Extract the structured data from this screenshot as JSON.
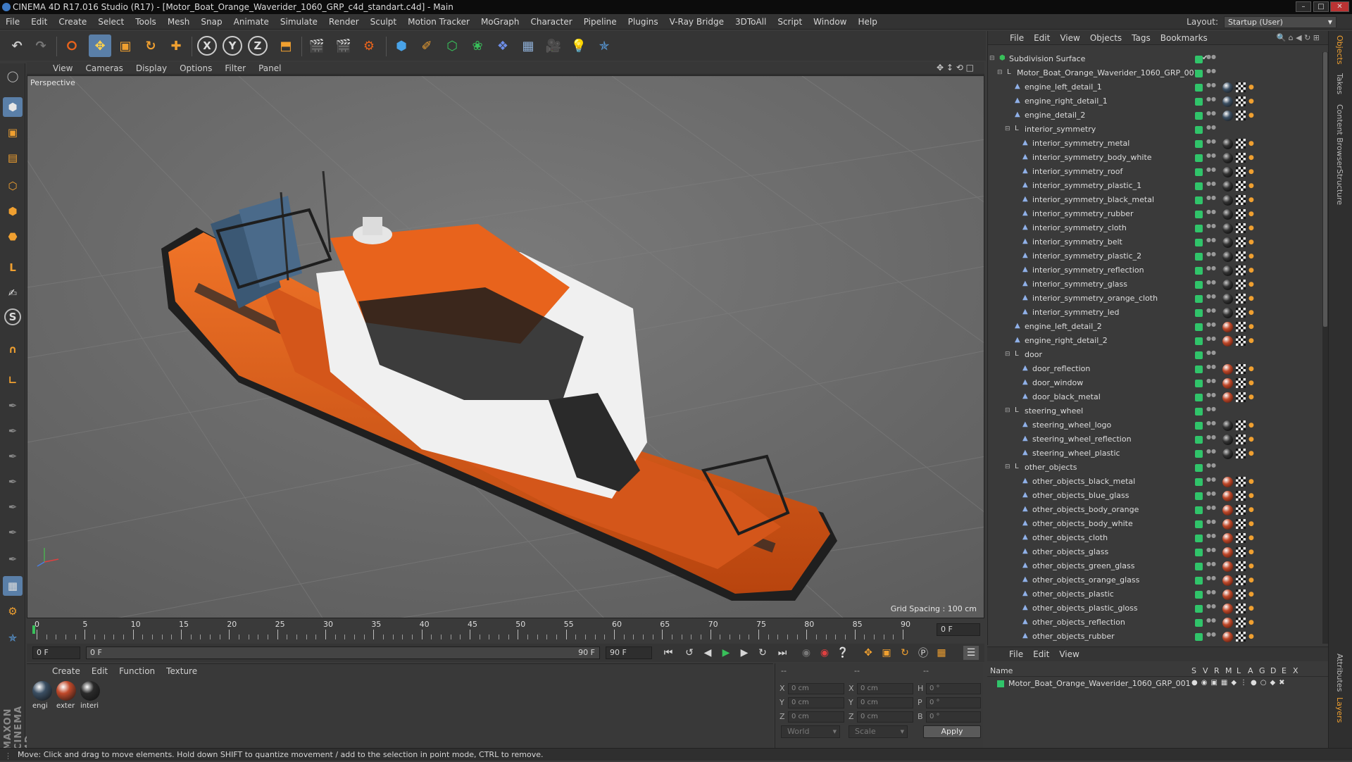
{
  "window": {
    "title": "CINEMA 4D R17.016 Studio (R17) - [Motor_Boat_Orange_Waverider_1060_GRP_c4d_standart.c4d] - Main"
  },
  "menubar": [
    "File",
    "Edit",
    "Create",
    "Select",
    "Tools",
    "Mesh",
    "Snap",
    "Animate",
    "Simulate",
    "Render",
    "Sculpt",
    "Motion Tracker",
    "MoGraph",
    "Character",
    "Pipeline",
    "Plugins",
    "V-Ray Bridge",
    "3DToAll",
    "Script",
    "Window",
    "Help"
  ],
  "layout": {
    "label": "Layout:",
    "value": "Startup (User)"
  },
  "viewport": {
    "menu": [
      "View",
      "Cameras",
      "Display",
      "Options",
      "Filter",
      "Panel"
    ],
    "label": "Perspective",
    "grid_spacing": "Grid Spacing : 100 cm"
  },
  "timeline": {
    "ticks": [
      "0",
      "5",
      "10",
      "15",
      "20",
      "25",
      "30",
      "35",
      "40",
      "45",
      "50",
      "55",
      "60",
      "65",
      "70",
      "75",
      "80",
      "85",
      "90"
    ],
    "current_frame": "0 F",
    "start_field": "0 F",
    "range_start": "0 F",
    "range_end": "90 F",
    "end_field": "90 F"
  },
  "materials": {
    "menu": [
      "Create",
      "Edit",
      "Function",
      "Texture"
    ],
    "items": [
      {
        "label": "engi",
        "color": "#3b4f63"
      },
      {
        "label": "exter",
        "color": "#c0492a"
      },
      {
        "label": "interi",
        "color": "#2a2a2a"
      }
    ]
  },
  "coords": {
    "headers": [
      "--",
      "--",
      "--"
    ],
    "rows": [
      {
        "a": "X",
        "av": "0 cm",
        "b": "X",
        "bv": "0 cm",
        "c": "H",
        "cv": "0 °"
      },
      {
        "a": "Y",
        "av": "0 cm",
        "b": "Y",
        "bv": "0 cm",
        "c": "P",
        "cv": "0 °"
      },
      {
        "a": "Z",
        "av": "0 cm",
        "b": "Z",
        "bv": "0 cm",
        "c": "B",
        "cv": "0 °"
      }
    ],
    "world": "World",
    "scale": "Scale",
    "apply": "Apply"
  },
  "status": "Move: Click and drag to move elements. Hold down SHIFT to quantize movement / add to the selection in point mode, CTRL to remove.",
  "object_manager": {
    "menu": [
      "File",
      "Edit",
      "View",
      "Objects",
      "Tags",
      "Bookmarks"
    ],
    "objects": [
      {
        "name": "Subdivision Surface",
        "indent": 0,
        "kind": "subdiv",
        "tag": "none"
      },
      {
        "name": "Motor_Boat_Orange_Waverider_1060_GRP_001",
        "indent": 1,
        "kind": "null",
        "tag": "none"
      },
      {
        "name": "engine_left_detail_1",
        "indent": 2,
        "kind": "mesh",
        "tag": "blue"
      },
      {
        "name": "engine_right_detail_1",
        "indent": 2,
        "kind": "mesh",
        "tag": "blue"
      },
      {
        "name": "engine_detail_2",
        "indent": 2,
        "kind": "mesh",
        "tag": "blue"
      },
      {
        "name": "interior_symmetry",
        "indent": 2,
        "kind": "null",
        "tag": "none"
      },
      {
        "name": "interior_symmetry_metal",
        "indent": 3,
        "kind": "mesh",
        "tag": "dark"
      },
      {
        "name": "interior_symmetry_body_white",
        "indent": 3,
        "kind": "mesh",
        "tag": "dark"
      },
      {
        "name": "interior_symmetry_roof",
        "indent": 3,
        "kind": "mesh",
        "tag": "dark"
      },
      {
        "name": "interior_symmetry_plastic_1",
        "indent": 3,
        "kind": "mesh",
        "tag": "dark"
      },
      {
        "name": "interior_symmetry_black_metal",
        "indent": 3,
        "kind": "mesh",
        "tag": "dark"
      },
      {
        "name": "interior_symmetry_rubber",
        "indent": 3,
        "kind": "mesh",
        "tag": "dark"
      },
      {
        "name": "interior_symmetry_cloth",
        "indent": 3,
        "kind": "mesh",
        "tag": "dark"
      },
      {
        "name": "interior_symmetry_belt",
        "indent": 3,
        "kind": "mesh",
        "tag": "dark"
      },
      {
        "name": "interior_symmetry_plastic_2",
        "indent": 3,
        "kind": "mesh",
        "tag": "dark"
      },
      {
        "name": "interior_symmetry_reflection",
        "indent": 3,
        "kind": "mesh",
        "tag": "dark"
      },
      {
        "name": "interior_symmetry_glass",
        "indent": 3,
        "kind": "mesh",
        "tag": "dark"
      },
      {
        "name": "interior_symmetry_orange_cloth",
        "indent": 3,
        "kind": "mesh",
        "tag": "dark"
      },
      {
        "name": "interior_symmetry_led",
        "indent": 3,
        "kind": "mesh",
        "tag": "dark"
      },
      {
        "name": "engine_left_detail_2",
        "indent": 2,
        "kind": "mesh",
        "tag": "red"
      },
      {
        "name": "engine_right_detail_2",
        "indent": 2,
        "kind": "mesh",
        "tag": "red"
      },
      {
        "name": "door",
        "indent": 2,
        "kind": "null",
        "tag": "none"
      },
      {
        "name": "door_reflection",
        "indent": 3,
        "kind": "mesh",
        "tag": "red"
      },
      {
        "name": "door_window",
        "indent": 3,
        "kind": "mesh",
        "tag": "red"
      },
      {
        "name": "door_black_metal",
        "indent": 3,
        "kind": "mesh",
        "tag": "red"
      },
      {
        "name": "steering_wheel",
        "indent": 2,
        "kind": "null",
        "tag": "none"
      },
      {
        "name": "steering_wheel_logo",
        "indent": 3,
        "kind": "mesh",
        "tag": "dark"
      },
      {
        "name": "steering_wheel_reflection",
        "indent": 3,
        "kind": "mesh",
        "tag": "dark"
      },
      {
        "name": "steering_wheel_plastic",
        "indent": 3,
        "kind": "mesh",
        "tag": "dark"
      },
      {
        "name": "other_objects",
        "indent": 2,
        "kind": "null",
        "tag": "none"
      },
      {
        "name": "other_objects_black_metal",
        "indent": 3,
        "kind": "mesh",
        "tag": "red"
      },
      {
        "name": "other_objects_blue_glass",
        "indent": 3,
        "kind": "mesh",
        "tag": "red"
      },
      {
        "name": "other_objects_body_orange",
        "indent": 3,
        "kind": "mesh",
        "tag": "red"
      },
      {
        "name": "other_objects_body_white",
        "indent": 3,
        "kind": "mesh",
        "tag": "red"
      },
      {
        "name": "other_objects_cloth",
        "indent": 3,
        "kind": "mesh",
        "tag": "red"
      },
      {
        "name": "other_objects_glass",
        "indent": 3,
        "kind": "mesh",
        "tag": "red"
      },
      {
        "name": "other_objects_green_glass",
        "indent": 3,
        "kind": "mesh",
        "tag": "red"
      },
      {
        "name": "other_objects_orange_glass",
        "indent": 3,
        "kind": "mesh",
        "tag": "red"
      },
      {
        "name": "other_objects_plastic",
        "indent": 3,
        "kind": "mesh",
        "tag": "red"
      },
      {
        "name": "other_objects_plastic_gloss",
        "indent": 3,
        "kind": "mesh",
        "tag": "red"
      },
      {
        "name": "other_objects_reflection",
        "indent": 3,
        "kind": "mesh",
        "tag": "red"
      },
      {
        "name": "other_objects_rubber",
        "indent": 3,
        "kind": "mesh",
        "tag": "red"
      }
    ]
  },
  "side_tabs": [
    "Objects",
    "Takes",
    "Content Browser",
    "Structure"
  ],
  "side_tabs_bottom": [
    "Attributes",
    "Layers"
  ],
  "layer_manager": {
    "menu": [
      "File",
      "Edit",
      "View"
    ],
    "name_header": "Name",
    "columns": [
      "S",
      "V",
      "R",
      "M",
      "L",
      "A",
      "G",
      "D",
      "E",
      "X"
    ],
    "row_name": "Motor_Boat_Orange_Waverider_1060_GRP_001"
  },
  "colors": {
    "visible_green": "#30c46a",
    "accent_orange": "#e8631c",
    "highlight_blue": "#2e6fcf"
  }
}
